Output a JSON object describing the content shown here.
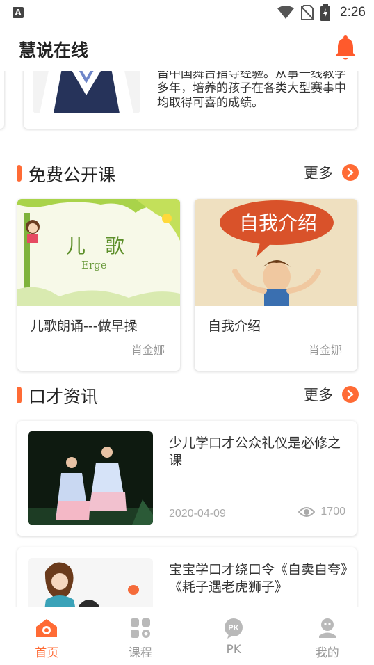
{
  "status_bar": {
    "time": "2:26",
    "app_icon": "A"
  },
  "header": {
    "title": "慧说在线",
    "bell_icon": "bell-icon"
  },
  "teacher": {
    "description": "留中国舞台指导经验。从事一线教学多年，培养的孩子在各类大型赛事中均取得可喜的成绩。"
  },
  "free_courses": {
    "title": "免费公开课",
    "more_label": "更多",
    "items": [
      {
        "title": "儿歌朗诵---做早操",
        "teacher": "肖金娜",
        "thumb_text": "儿　歌",
        "thumb_sub": "Erge"
      },
      {
        "title": "自我介绍",
        "teacher": "肖金娜",
        "thumb_text": "自我介绍"
      }
    ]
  },
  "news": {
    "title": "口才资讯",
    "more_label": "更多",
    "items": [
      {
        "title": "少儿学口才公众礼仪是必修之课",
        "date": "2020-04-09",
        "views": "1700"
      },
      {
        "title": "宝宝学口才绕口令《自卖自夸》《耗子遇老虎狮子》"
      }
    ]
  },
  "bottom_nav": {
    "items": [
      {
        "label": "首页",
        "icon": "home-icon",
        "active": true
      },
      {
        "label": "课程",
        "icon": "course-grid-icon"
      },
      {
        "label": "PK",
        "icon": "pk-icon"
      },
      {
        "label": "我的",
        "icon": "profile-icon"
      }
    ]
  },
  "colors": {
    "accent": "#ff6b35",
    "text": "#222222",
    "muted": "#999999"
  }
}
